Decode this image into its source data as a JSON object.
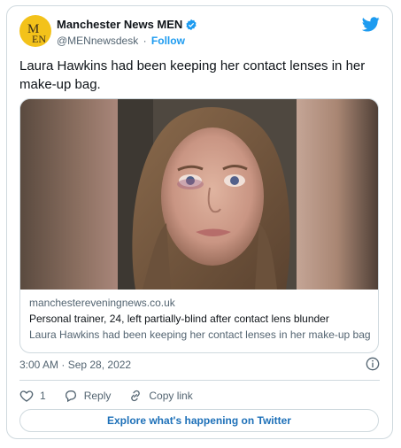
{
  "account": {
    "name": "Manchester News MEN",
    "handle": "@MENnewsdesk",
    "separator": "·",
    "follow_label": "Follow",
    "avatar_text": "MEN"
  },
  "tweet": {
    "text": "Laura Hawkins had been keeping her contact lenses in her make-up bag."
  },
  "link_card": {
    "domain": "manchestereveningnews.co.uk",
    "title": "Personal trainer, 24, left partially-blind after contact lens blunder",
    "description": "Laura Hawkins had been keeping her contact lenses in her make-up bag"
  },
  "meta": {
    "timestamp": "3:00 AM · Sep 28, 2022"
  },
  "actions": {
    "like_count": "1",
    "reply_label": "Reply",
    "copy_link_label": "Copy link"
  },
  "explore_label": "Explore what's happening on Twitter",
  "colors": {
    "accent": "#1d9bf0",
    "avatar_bg": "#f3c21a",
    "border": "#cfd9de",
    "muted_text": "#536471"
  },
  "icons": [
    "twitter-bird-icon",
    "verified-badge-icon",
    "info-icon",
    "heart-icon",
    "reply-icon",
    "link-icon"
  ]
}
